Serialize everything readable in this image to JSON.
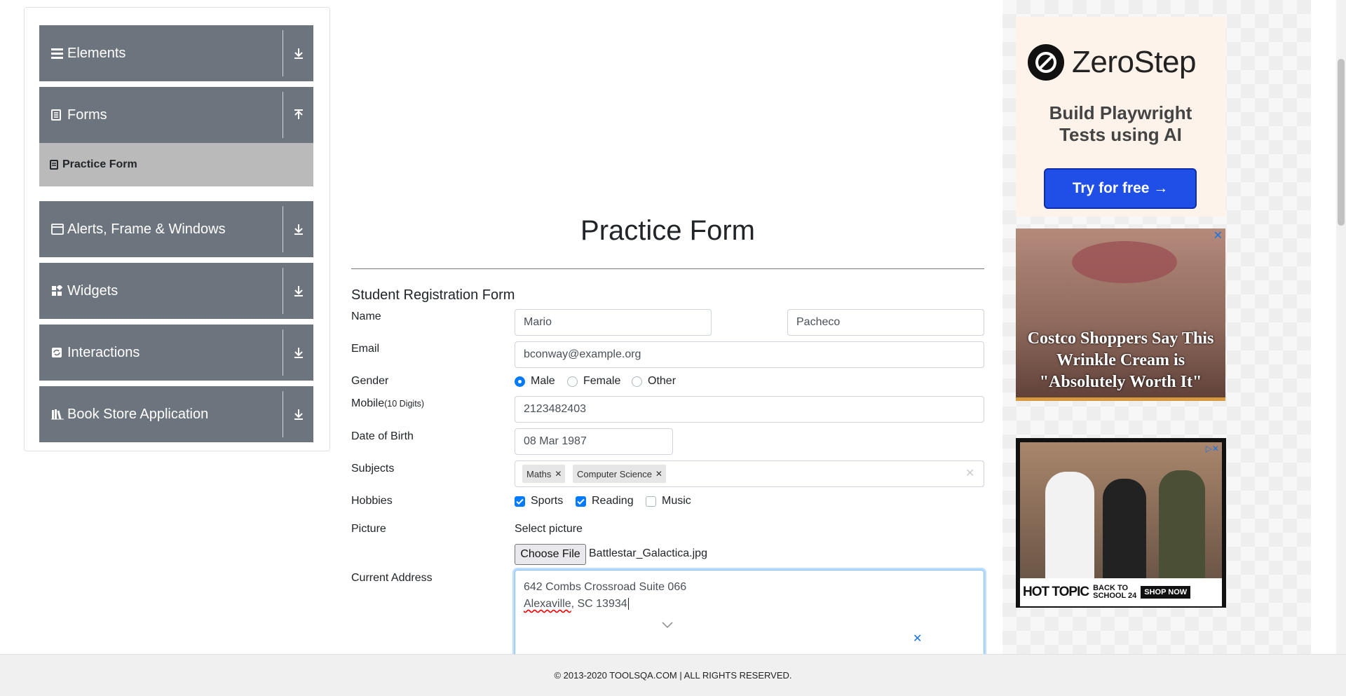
{
  "sidebar": {
    "groups": [
      {
        "label": "Elements",
        "icon": "list-icon",
        "toggle": "download-icon"
      },
      {
        "label": "Forms",
        "icon": "document-icon",
        "toggle": "upload-icon"
      },
      {
        "label": "Alerts, Frame & Windows",
        "icon": "window-icon",
        "toggle": "download-icon"
      },
      {
        "label": "Widgets",
        "icon": "widgets-icon",
        "toggle": "download-icon"
      },
      {
        "label": "Interactions",
        "icon": "refresh-icon",
        "toggle": "download-icon"
      },
      {
        "label": "Book Store Application",
        "icon": "books-icon",
        "toggle": "download-icon"
      }
    ],
    "active_item": {
      "label": "Practice Form"
    }
  },
  "page": {
    "title": "Practice Form",
    "subtitle": "Student Registration Form"
  },
  "form": {
    "name_label": "Name",
    "first_name": "Mario",
    "last_name": "Pacheco",
    "email_label": "Email",
    "email": "bconway@example.org",
    "gender_label": "Gender",
    "gender_options": [
      "Male",
      "Female",
      "Other"
    ],
    "gender_selected": "Male",
    "mobile_label": "Mobile",
    "mobile_hint": "(10 Digits)",
    "mobile": "2123482403",
    "dob_label": "Date of Birth",
    "dob": "08 Mar 1987",
    "subjects_label": "Subjects",
    "subjects": [
      "Maths",
      "Computer Science"
    ],
    "hobbies_label": "Hobbies",
    "hobbies": [
      {
        "label": "Sports",
        "checked": true
      },
      {
        "label": "Reading",
        "checked": true
      },
      {
        "label": "Music",
        "checked": false
      }
    ],
    "picture_label": "Picture",
    "picture_prompt": "Select picture",
    "file_button": "Choose File",
    "file_name": "Battlestar_Galactica.jpg",
    "address_label": "Current Address",
    "address_line1": "642 Combs Crossroad Suite 066",
    "address_line2_word": "Alexaville",
    "address_line2_rest": ", SC 13934"
  },
  "ads": {
    "top": {
      "brand": "ZeroStep",
      "tagline_line1": "Build Playwright",
      "tagline_line2": "Tests using AI",
      "cta": "Try for free →"
    },
    "middle": {
      "headline_line1": "Costco Shoppers Say This",
      "headline_line2": "Wrinkle Cream is",
      "headline_line3": "\"Absolutely Worth It\""
    },
    "bottom": {
      "brand": "HOT TOPIC",
      "promo_line1": "BACK TO",
      "promo_line2": "SCHOOL 24",
      "cta": "SHOP NOW"
    }
  },
  "footer": {
    "text": "© 2013-2020 TOOLSQA.COM | ALL RIGHTS RESERVED."
  },
  "colors": {
    "sidebar_header": "#6c757d",
    "active_item": "#bababa",
    "accent": "#007bff"
  }
}
